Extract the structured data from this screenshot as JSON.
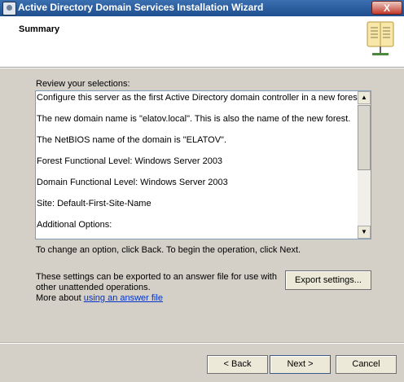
{
  "window": {
    "title": "Active Directory Domain Services Installation Wizard",
    "close_glyph": "X"
  },
  "header": {
    "title": "Summary",
    "icon": "book-icon"
  },
  "review_label": "Review your selections:",
  "selections": [
    "Configure this server as the first Active Directory domain controller in a new forest.",
    "The new domain name is \"elatov.local\". This is also the name of the new forest.",
    "The NetBIOS name of the domain is \"ELATOV\".",
    "Forest Functional Level: Windows Server 2003",
    "Domain Functional Level: Windows Server 2003",
    "Site: Default-First-Site-Name",
    "Additional Options:"
  ],
  "change_hint": "To change an option, click Back. To begin the operation, click Next.",
  "export": {
    "text_line1": "These settings can be exported to an answer file for use with",
    "text_line2": "other unattended operations.",
    "more_prefix": "More about",
    "link_text": "using an answer file",
    "button_label": "Export settings..."
  },
  "footer": {
    "back_label": "< Back",
    "next_label": "Next >",
    "cancel_label": "Cancel"
  }
}
